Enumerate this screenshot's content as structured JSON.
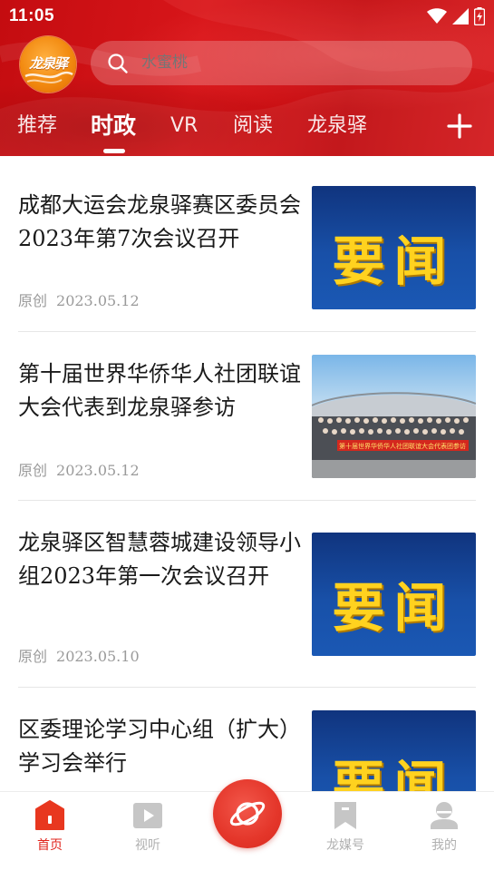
{
  "status_bar": {
    "time": "11:05"
  },
  "app": {
    "logo_text": "龙泉驿"
  },
  "search": {
    "placeholder": "水蜜桃"
  },
  "tabs": [
    {
      "label": "推荐",
      "active": false
    },
    {
      "label": "时政",
      "active": true
    },
    {
      "label": "VR",
      "active": false
    },
    {
      "label": "阅读",
      "active": false
    },
    {
      "label": "龙泉驿",
      "active": false
    }
  ],
  "feed": {
    "items": [
      {
        "title": "成都大运会龙泉驿赛区委员会2023年第7次会议召开",
        "source": "原创",
        "date": "2023.05.12",
        "thumb": "要闻"
      },
      {
        "title": "第十届世界华侨华人社团联谊大会代表到龙泉驿参访",
        "source": "原创",
        "date": "2023.05.12",
        "thumb_caption": "第十届世界华侨华人社团联谊大会代表团参访"
      },
      {
        "title": "龙泉驿区智慧蓉城建设领导小组2023年第一次会议召开",
        "source": "原创",
        "date": "2023.05.10",
        "thumb": "要闻"
      },
      {
        "title": "区委理论学习中心组（扩大）学习会举行",
        "thumb": "要闻"
      }
    ]
  },
  "bottom_nav": [
    {
      "label": "首页",
      "icon": "home-icon",
      "active": true
    },
    {
      "label": "视听",
      "icon": "play-icon",
      "active": false
    },
    {
      "label": "",
      "icon": "planet-icon",
      "active": false
    },
    {
      "label": "龙媒号",
      "icon": "bookmark-icon",
      "active": false
    },
    {
      "label": "我的",
      "icon": "user-icon",
      "active": false
    }
  ],
  "colors": {
    "brand_red": "#d8161a",
    "accent_yellow": "#ffd21f",
    "thumb_blue": "#1850a8",
    "inactive_gray": "#b0b0b0"
  }
}
